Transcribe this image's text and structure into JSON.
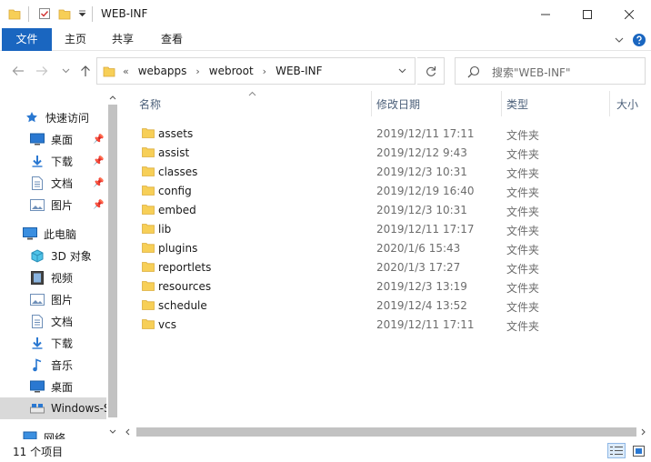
{
  "window": {
    "title": "WEB-INF"
  },
  "ribbon": {
    "tabs": [
      "文件",
      "主页",
      "共享",
      "查看"
    ]
  },
  "address": {
    "overflow": "«",
    "crumbs": [
      "webapps",
      "webroot",
      "WEB-INF"
    ],
    "search_placeholder": "搜索\"WEB-INF\""
  },
  "nav": {
    "items": [
      {
        "label": "快速访问",
        "icon": "star-icon",
        "pinned": false
      },
      {
        "label": "桌面",
        "icon": "desktop-icon",
        "pinned": true
      },
      {
        "label": "下载",
        "icon": "download-icon",
        "pinned": true
      },
      {
        "label": "文档",
        "icon": "document-icon",
        "pinned": true
      },
      {
        "label": "图片",
        "icon": "pictures-icon",
        "pinned": true
      },
      {
        "label": "此电脑",
        "icon": "computer-icon",
        "pinned": false
      },
      {
        "label": "3D 对象",
        "icon": "cube-icon",
        "pinned": false
      },
      {
        "label": "视频",
        "icon": "video-icon",
        "pinned": false
      },
      {
        "label": "图片",
        "icon": "pictures-icon",
        "pinned": false
      },
      {
        "label": "文档",
        "icon": "document-icon",
        "pinned": false
      },
      {
        "label": "下载",
        "icon": "download-icon",
        "pinned": false
      },
      {
        "label": "音乐",
        "icon": "music-icon",
        "pinned": false
      },
      {
        "label": "桌面",
        "icon": "desktop-icon",
        "pinned": false
      },
      {
        "label": "Windows-S",
        "icon": "drive-icon",
        "pinned": false
      },
      {
        "label": "网络",
        "icon": "network-icon",
        "pinned": false
      }
    ]
  },
  "columns": {
    "name": "名称",
    "date": "修改日期",
    "type": "类型",
    "size": "大小"
  },
  "files": [
    {
      "name": "assets",
      "date": "2019/12/11 17:11",
      "type": "文件夹"
    },
    {
      "name": "assist",
      "date": "2019/12/12 9:43",
      "type": "文件夹"
    },
    {
      "name": "classes",
      "date": "2019/12/3 10:31",
      "type": "文件夹"
    },
    {
      "name": "config",
      "date": "2019/12/19 16:40",
      "type": "文件夹"
    },
    {
      "name": "embed",
      "date": "2019/12/3 10:31",
      "type": "文件夹"
    },
    {
      "name": "lib",
      "date": "2019/12/11 17:17",
      "type": "文件夹"
    },
    {
      "name": "plugins",
      "date": "2020/1/6 15:43",
      "type": "文件夹"
    },
    {
      "name": "reportlets",
      "date": "2020/1/3 17:27",
      "type": "文件夹"
    },
    {
      "name": "resources",
      "date": "2019/12/3 13:19",
      "type": "文件夹"
    },
    {
      "name": "schedule",
      "date": "2019/12/4 13:52",
      "type": "文件夹"
    },
    {
      "name": "vcs",
      "date": "2019/12/11 17:11",
      "type": "文件夹"
    }
  ],
  "status": {
    "count": "11 个项目"
  },
  "colors": {
    "accent": "#1a66c0",
    "folder": "#f7cf57",
    "selection": "#d9d9d9"
  }
}
